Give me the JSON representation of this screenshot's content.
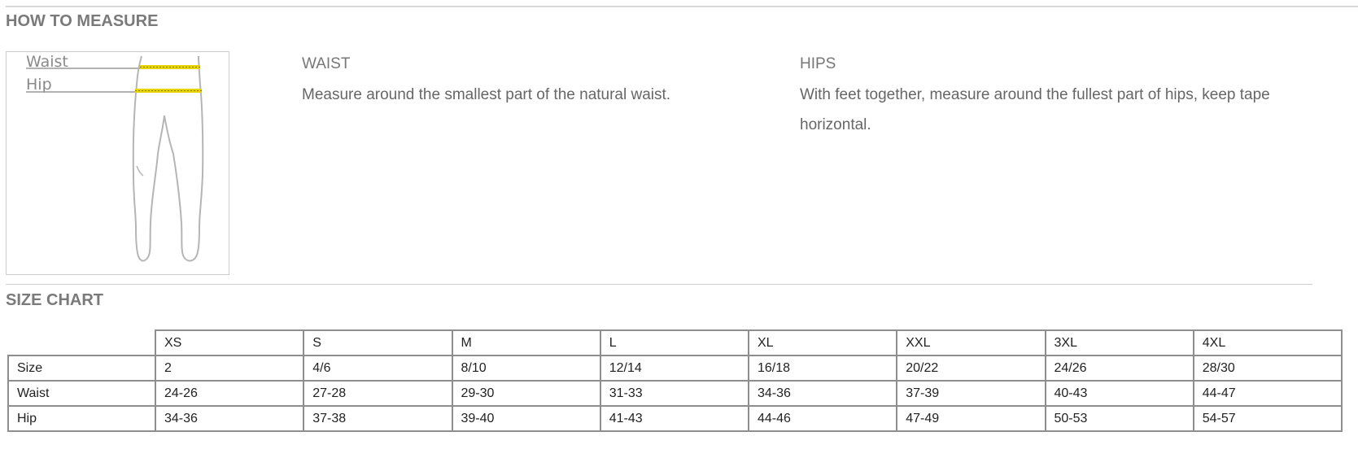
{
  "measure_section": {
    "title": "HOW TO MEASURE",
    "diagram": {
      "labels": [
        "Waist",
        "Hip"
      ],
      "band_color": "#e8d400"
    },
    "waist": {
      "heading": "WAIST",
      "text": "Measure around the smallest part of the natural waist."
    },
    "hips": {
      "heading": "HIPS",
      "text": "With feet together, measure around the fullest part of hips, keep tape horizontal."
    }
  },
  "size_chart": {
    "title": "SIZE CHART",
    "columns": [
      "XS",
      "S",
      "M",
      "L",
      "XL",
      "XXL",
      "3XL",
      "4XL"
    ],
    "rows": [
      {
        "label": "Size",
        "values": [
          "2",
          "4/6",
          "8/10",
          "12/14",
          "16/18",
          "20/22",
          "24/26",
          "28/30"
        ]
      },
      {
        "label": "Waist",
        "values": [
          "24-26",
          "27-28",
          "29-30",
          "31-33",
          "34-36",
          "37-39",
          "40-43",
          "44-47"
        ]
      },
      {
        "label": "Hip",
        "values": [
          "34-36",
          "37-38",
          "39-40",
          "41-43",
          "44-46",
          "47-49",
          "50-53",
          "54-57"
        ]
      }
    ]
  }
}
